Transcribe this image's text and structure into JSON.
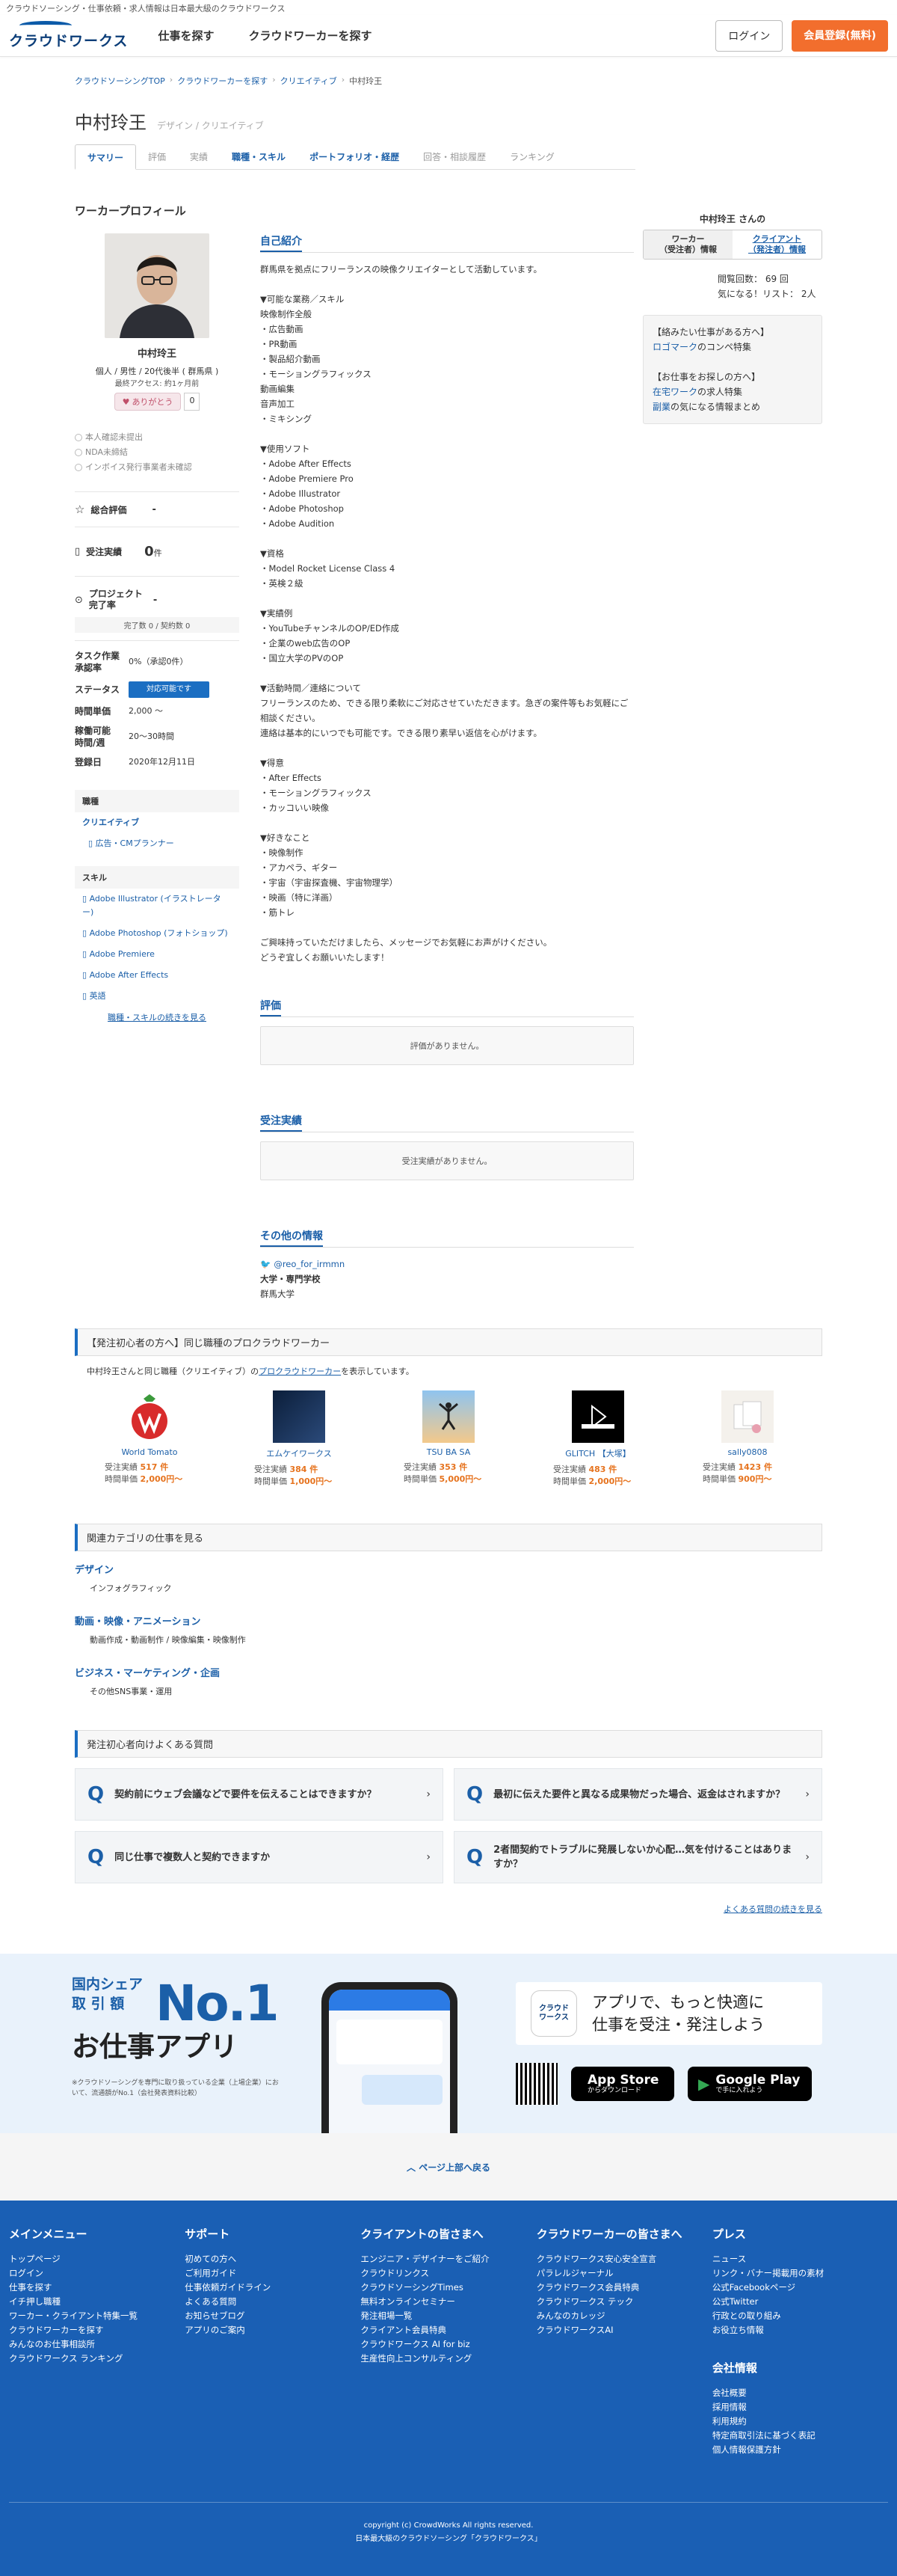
{
  "topbar": {
    "text": "クラウドソーシング・仕事依頼・求人情報は日本最大級のクラウドワークス"
  },
  "header": {
    "logo_text": "クラウドワークス",
    "nav": [
      "仕事を探す",
      "クラウドワーカーを探す"
    ],
    "login_label": "ログイン",
    "signup_label": "会員登録(無料)"
  },
  "breadcrumb": [
    "クラウドソーシングTOP",
    "クラウドワーカーを探す",
    "クリエイティブ",
    "中村玲王"
  ],
  "worker": {
    "name": "中村玲王",
    "roles": [
      "デザイン",
      "クリエイティブ"
    ],
    "roles_sep": "/"
  },
  "tabs": [
    {
      "label": "サマリー",
      "state": "active"
    },
    {
      "label": "評価",
      "state": "muted"
    },
    {
      "label": "実績",
      "state": "muted"
    },
    {
      "label": "職種・スキル",
      "state": "link"
    },
    {
      "label": "ポートフォリオ・経歴",
      "state": "link"
    },
    {
      "label": "回答・相談履歴",
      "state": "muted"
    },
    {
      "label": "ランキング",
      "state": "muted"
    }
  ],
  "right_panel": {
    "title": "中村玲王 さんの",
    "tab_worker": "ワーカー\n（受注者）情報",
    "tab_client": "クライアント\n（発注者）情報",
    "stats": [
      {
        "label": "閲覧回数：",
        "value": "69 回"
      },
      {
        "label": "気になる！リスト：",
        "value": "2人"
      }
    ],
    "box_lines": [
      {
        "text": "【絡みたい仕事がある方へ】",
        "link": false
      },
      {
        "text": "ロゴマーク",
        "link": true,
        "suffix": "のコンペ特集"
      },
      {
        "text": "",
        "link": false
      },
      {
        "text": "【お仕事をお探しの方へ】",
        "link": false
      },
      {
        "text": "在宅ワーク",
        "link": true,
        "suffix": "の求人特集"
      },
      {
        "text": "副業",
        "link": true,
        "suffix": "の気になる情報まとめ"
      }
    ]
  },
  "profile_section_title": "ワーカープロフィール",
  "profile": {
    "display_name": "中村玲王",
    "meta": "個人 / 男性 / 20代後半 ( 群馬県 )",
    "last_access": "最終アクセス: 約1ヶ月前",
    "thanks_label": "ありがとう",
    "thanks_count": "0",
    "verifications": [
      "本人確認未提出",
      "NDA未締結",
      "インボイス発行事業者未確認"
    ],
    "rating_label": "総合評価",
    "rating_value": "-",
    "orders_label": "受注実績",
    "orders_value": "0",
    "orders_unit": "件",
    "project_label": "プロジェクト\n完了率",
    "project_value": "-",
    "complete_text": "完了数 0 / 契約数 0",
    "task_label": "タスク作業\n承認率",
    "task_value": "0%（承認0件）",
    "status_label": "ステータス",
    "status_value": "対応可能です",
    "rate_label": "時間単価",
    "rate_value": "2,000 〜",
    "hours_label": "稼働可能\n時間/週",
    "hours_value": "20〜30時間",
    "registered_label": "登録日",
    "registered_value": "2020年12月11日",
    "job_head": "職種",
    "job_main": "クリエイティブ",
    "job_sub": "広告・CMプランナー",
    "skill_head": "スキル",
    "skills": [
      "Adobe Illustrator (イラストレーター)",
      "Adobe Photoshop (フォトショップ)",
      "Adobe Premiere",
      "Adobe After Effects",
      "英語"
    ],
    "more_skills": "職種・スキルの続きを見る"
  },
  "intro": {
    "title": "自己紹介",
    "text": "群馬県を拠点にフリーランスの映像クリエイターとして活動しています。\n\n▼可能な業務／スキル\n映像制作全般\n・広告動画\n・PR動画\n・製品紹介動画\n・モーショングラフィックス\n動画編集\n音声加工\n・ミキシング\n\n▼使用ソフト\n・Adobe After Effects\n・Adobe Premiere Pro\n・Adobe Illustrator\n・Adobe Photoshop\n・Adobe Audition\n\n▼資格\n・Model Rocket License Class 4\n・英検２級\n\n▼実績例\n・YouTubeチャンネルのOP/ED作成\n・企業のweb広告のOP\n・国立大学のPVのOP\n\n▼活動時間／連絡について\nフリーランスのため、できる限り柔軟にご対応させていただきます。急ぎの案件等もお気軽にご相談ください。\n連絡は基本的にいつでも可能です。できる限り素早い返信を心がけます。\n\n▼得意\n・After Effects\n・モーショングラフィックス\n・カッコいい映像\n\n▼好きなこと\n・映像制作\n・アカペラ、ギター\n・宇宙（宇宙探査機、宇宙物理学）\n・映画（特に洋画）\n・筋トレ\n\nご興味持っていただけましたら、メッセージでお気軽にお声がけください。\nどうぞ宜しくお願いいたします！"
  },
  "reviews": {
    "title": "評価",
    "empty": "評価がありません。"
  },
  "orders": {
    "title": "受注実績",
    "empty": "受注実績がありません。"
  },
  "other_info": {
    "title": "その他の情報",
    "twitter": "@reo_for_irmmn",
    "edu_label": "大学・専門学校",
    "edu_value": "群馬大学"
  },
  "similar": {
    "title": "【発注初心者の方へ】同じ職種のプロクラウドワーカー",
    "sub_prefix": "中村玲王さんと同じ職種（クリエイティブ）の",
    "sub_link": "プロクラウドワーカー",
    "sub_suffix": "を表示しています。",
    "orders_label": "受注実績",
    "rate_label": "時間単価",
    "workers": [
      {
        "name": "World Tomato",
        "orders": "517 件",
        "rate": "2,000円〜"
      },
      {
        "name": "エムケイワークス",
        "orders": "384 件",
        "rate": "1,000円〜"
      },
      {
        "name": "TSU BA SA",
        "orders": "353 件",
        "rate": "5,000円〜"
      },
      {
        "name": "GLITCH 【大塚】",
        "orders": "483 件",
        "rate": "2,000円〜"
      },
      {
        "name": "sally0808",
        "orders": "1423 件",
        "rate": "900円〜"
      }
    ]
  },
  "categories": {
    "title": "関連カテゴリの仕事を見る",
    "items": [
      {
        "name": "デザイン",
        "sub": "インフォグラフィック"
      },
      {
        "name": "動画・映像・アニメーション",
        "sub": "動画作成・動画制作 / 映像編集・映像制作"
      },
      {
        "name": "ビジネス・マーケティング・企画",
        "sub": "その他SNS事業・運用"
      }
    ]
  },
  "faq": {
    "title": "発注初心者向けよくある質問",
    "q_mark": "Q",
    "items": [
      "契約前にウェブ会議などで要件を伝えることはできますか？",
      "最初に伝えた要件と異なる成果物だった場合、返金はされますか？",
      "同じ仕事で複数人と契約できますか",
      "2者間契約でトラブルに発展しないか心配…気を付けることはありますか？"
    ],
    "more": "よくある質問の続きを見る"
  },
  "app": {
    "share_line1": "国内シェア",
    "share_line2": "取 引 額",
    "no1": "No.1",
    "headline": "お仕事アプリ",
    "note": "※クラウドソーシングを専門に取り扱っている企業（上場企業）において、流通額がNo.1（会社発表資料比較）",
    "logo_text": "クラウド\nワークス",
    "catch_line1": "アプリで、もっと快適に",
    "catch_line2": "仕事を受注・発注しよう",
    "appstore_small": "",
    "appstore_big": "App Store",
    "appstore_sub": "からダウンロード",
    "gplay_big": "Google Play",
    "gplay_sub": "で手に入れよう"
  },
  "back_to_top": "ページ上部へ戻る",
  "footer": {
    "cols": [
      {
        "head": "メインメニュー",
        "links": [
          "トップページ",
          "ログイン",
          "仕事を探す",
          "イチ押し職種",
          "ワーカー・クライアント特集一覧",
          "クラウドワーカーを探す",
          "みんなのお仕事相談所",
          "クラウドワークス ランキング"
        ]
      },
      {
        "head": "サポート",
        "links": [
          "初めての方へ",
          "ご利用ガイド",
          "仕事依頼ガイドライン",
          "よくある質問",
          "お知らせブログ",
          "アプリのご案内"
        ]
      },
      {
        "head": "クライアントの皆さまへ",
        "links": [
          "エンジニア・デザイナーをご紹介",
          "クラウドリンクス",
          "クラウドソーシングTimes",
          "無料オンラインセミナー",
          "発注相場一覧",
          "クライアント会員特典",
          "クラウドワークス AI for biz",
          "生産性向上コンサルティング"
        ]
      },
      {
        "head": "クラウドワーカーの皆さまへ",
        "links": [
          "クラウドワークス安心安全宣言",
          "パラレルジャーナル",
          "クラウドワークス会員特典",
          "クラウドワークス テック",
          "みんなのカレッジ",
          "クラウドワークスAI"
        ]
      },
      {
        "head": "プレス",
        "links": [
          "ニュース",
          "リンク・バナー掲載用の素材",
          "公式Facebookページ",
          "公式Twitter",
          "行政との取り組み",
          "お役立ち情報"
        ],
        "head2": "会社情報",
        "links2": [
          "会社概要",
          "採用情報",
          "利用規約",
          "特定商取引法に基づく表記",
          "個人情報保護方針"
        ]
      }
    ],
    "copyright": "copyright (c) CrowdWorks All rights reserved.",
    "tagline": "日本最大級のクラウドソーシング「クラウドワークス」"
  }
}
